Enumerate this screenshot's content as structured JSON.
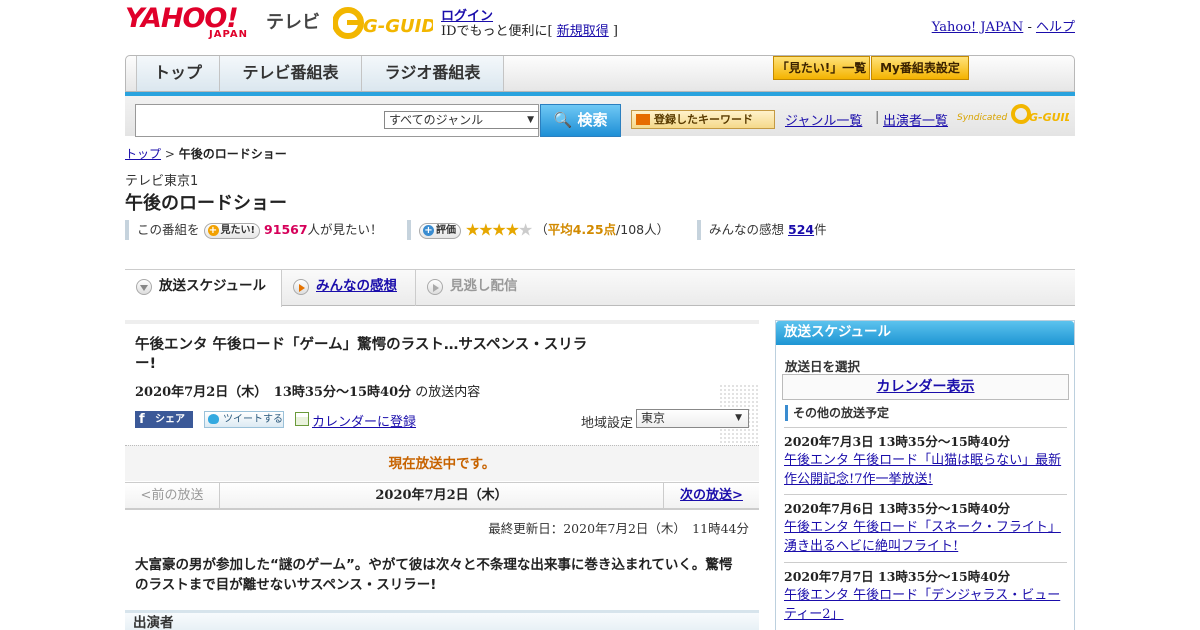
{
  "header": {
    "logo_yahoo": "YAHOO!",
    "logo_japan": "JAPAN",
    "logo_tv": "テレビ",
    "logo_gguide": "G-GUIDE",
    "login": "ログイン",
    "login_sub_prefix": "IDでもっと便利に[ ",
    "signup": "新規取得",
    "login_sub_suffix": " ]",
    "yahoo_japan": "Yahoo! JAPAN",
    "separator": " - ",
    "help": "ヘルプ"
  },
  "nav": {
    "tabs": [
      "トップ",
      "テレビ番組表",
      "ラジオ番組表"
    ],
    "mitai_list": "「見たい!」一覧",
    "my_settings": "My番組表設定"
  },
  "search": {
    "genre_selected": "すべてのジャンル",
    "button": "検索",
    "keyword_button": "登録したキーワード",
    "genre_list": "ジャンル一覧",
    "bar": "|",
    "performer_list": "出演者一覧",
    "syndicated": "Syndicated"
  },
  "breadcrumb": {
    "top": "トップ",
    "sep": " > ",
    "current": "午後のロードショー"
  },
  "program": {
    "channel": "テレビ東京1",
    "title": "午後のロードショー",
    "mitai_prefix": "この番組を",
    "mitai_button": "見たい!",
    "mitai_count": "91567",
    "mitai_suffix": "人が見たい！",
    "rating_button": "評価",
    "stars": "★★★★",
    "stars_off": "★",
    "rating_prefix": "（",
    "rating_avg": "平均4.25点",
    "rating_suffix": "/108人）",
    "impressions_label": "みんなの感想",
    "impressions_count": "524",
    "impressions_unit": "件"
  },
  "ptabs": {
    "schedule": "放送スケジュール",
    "reviews": "みんなの感想",
    "vod": "見逃し配信"
  },
  "episode": {
    "title": "午後エンタ 午後ロード「ゲーム」驚愕のラスト…サスペンス・スリラー!",
    "date_bold": "2020年7月2日（木）　13時35分～15時40分",
    "date_suffix": " の放送内容",
    "fb_share": "シェア",
    "tweet": "ツイートする",
    "calendar_register": "カレンダーに登録",
    "region_label": "地域設定",
    "region_selected": "東京",
    "onair": "現在放送中です。",
    "prev": "<前の放送",
    "pager_date": "2020年7月2日（木）",
    "next": "次の放送>",
    "last_updated": "最終更新日：2020年7月2日（木）　11時44分",
    "description": "大富豪の男が参加した“謎のゲーム”。やがて彼は次々と不条理な出来事に巻き込まれていく。驚愕のラストまで目が離せないサスペンス・スリラー!",
    "cast_header": "出演者"
  },
  "sidebar": {
    "header": "放送スケジュール",
    "select_date": "放送日を選択",
    "calendar": "カレンダー表示",
    "other_title": "その他の放送予定",
    "items": [
      {
        "date": "2020年7月3日  13時35分～15時40分",
        "title": "午後エンタ 午後ロード「山猫は眠らない」最新作公開記念!7作一挙放送!"
      },
      {
        "date": "2020年7月6日  13時35分～15時40分",
        "title": "午後エンタ 午後ロード「スネーク・フライト」湧き出るヘビに絶叫フライト!"
      },
      {
        "date": "2020年7月7日  13時35分～15時40分",
        "title": "午後エンタ 午後ロード「デンジャラス・ビューティー2」"
      }
    ]
  }
}
